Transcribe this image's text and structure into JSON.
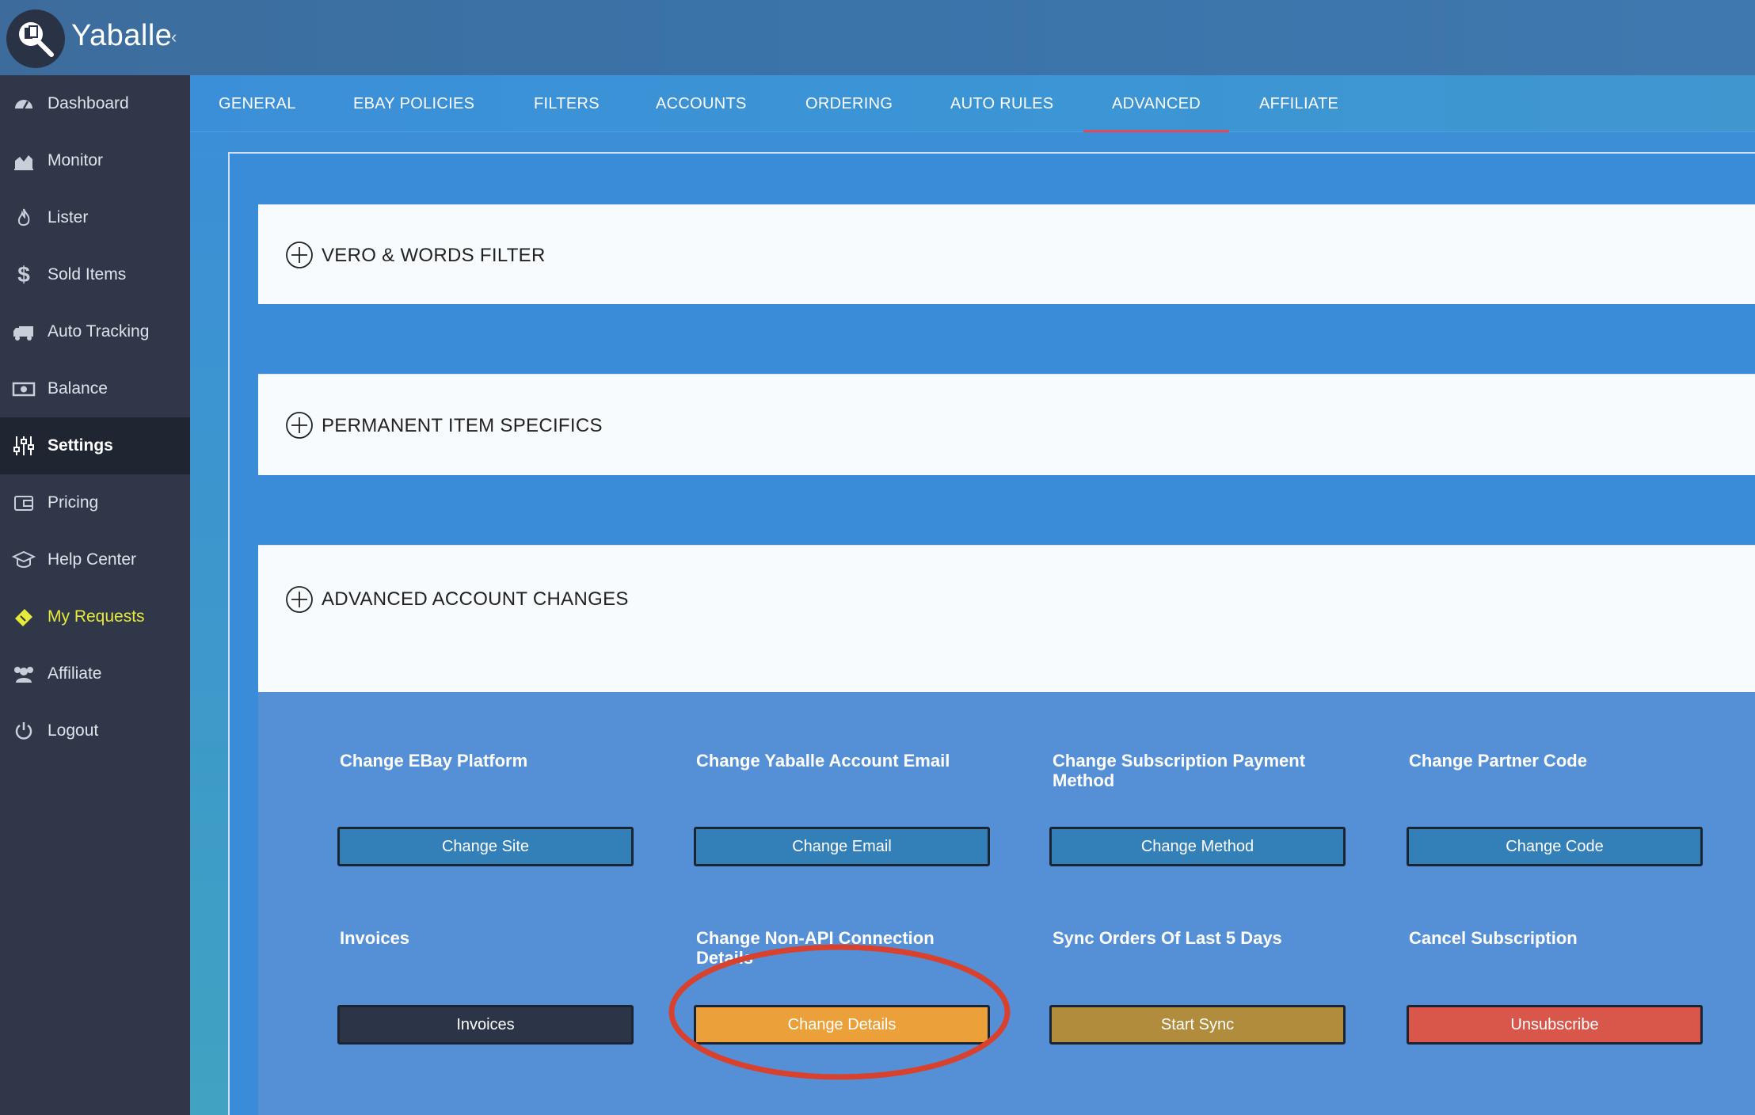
{
  "app": {
    "brand": "Yaballe",
    "collapse_glyph": "‹"
  },
  "sidebar": {
    "items": [
      {
        "label": "Dashboard",
        "icon": "dashboard-icon"
      },
      {
        "label": "Monitor",
        "icon": "area-chart-icon"
      },
      {
        "label": "Lister",
        "icon": "fire-icon"
      },
      {
        "label": "Sold Items",
        "icon": "dollar-icon"
      },
      {
        "label": "Auto Tracking",
        "icon": "truck-icon"
      },
      {
        "label": "Balance",
        "icon": "money-icon"
      },
      {
        "label": "Settings",
        "icon": "sliders-icon",
        "active": true
      },
      {
        "label": "Pricing",
        "icon": "wallet-icon"
      },
      {
        "label": "Help Center",
        "icon": "graduation-cap-icon"
      },
      {
        "label": "My Requests",
        "icon": "ticket-icon",
        "highlight_color": "#e6ea3a"
      },
      {
        "label": "Affiliate",
        "icon": "users-icon"
      },
      {
        "label": "Logout",
        "icon": "power-icon"
      }
    ]
  },
  "tabs": {
    "items": [
      {
        "label": "GENERAL"
      },
      {
        "label": "EBAY POLICIES"
      },
      {
        "label": "FILTERS"
      },
      {
        "label": "ACCOUNTS"
      },
      {
        "label": "ORDERING"
      },
      {
        "label": "AUTO RULES"
      },
      {
        "label": "ADVANCED",
        "active": true
      },
      {
        "label": "AFFILIATE"
      }
    ]
  },
  "panels": {
    "vero": {
      "title": "VERO & WORDS FILTER"
    },
    "specifics": {
      "title": "PERMANENT ITEM SPECIFICS"
    },
    "advanced": {
      "title": "ADVANCED ACCOUNT CHANGES"
    }
  },
  "advanced_changes": {
    "row1": [
      {
        "title": "Change EBay Platform",
        "button": "Change Site",
        "color": "#3380b8"
      },
      {
        "title": "Change Yaballe Account Email",
        "button": "Change Email",
        "color": "#3380b8"
      },
      {
        "title": "Change Subscription Payment Method",
        "button": "Change Method",
        "color": "#3380b8"
      },
      {
        "title": "Change Partner Code",
        "button": "Change Code",
        "color": "#3380b8"
      }
    ],
    "row2": [
      {
        "title": "Invoices",
        "button": "Invoices",
        "color": "#2c3448"
      },
      {
        "title": "Change Non-API Connection Details",
        "button": "Change Details",
        "color": "#eba03a"
      },
      {
        "title": "Sync Orders Of Last 5 Days",
        "button": "Start Sync",
        "color": "#b08c3c"
      },
      {
        "title": "Cancel Subscription",
        "button": "Unsubscribe",
        "color": "#d9574a"
      }
    ]
  },
  "colors": {
    "accent_tab_underline": "#e14a5a",
    "annotation_circle": "#d9412f"
  }
}
